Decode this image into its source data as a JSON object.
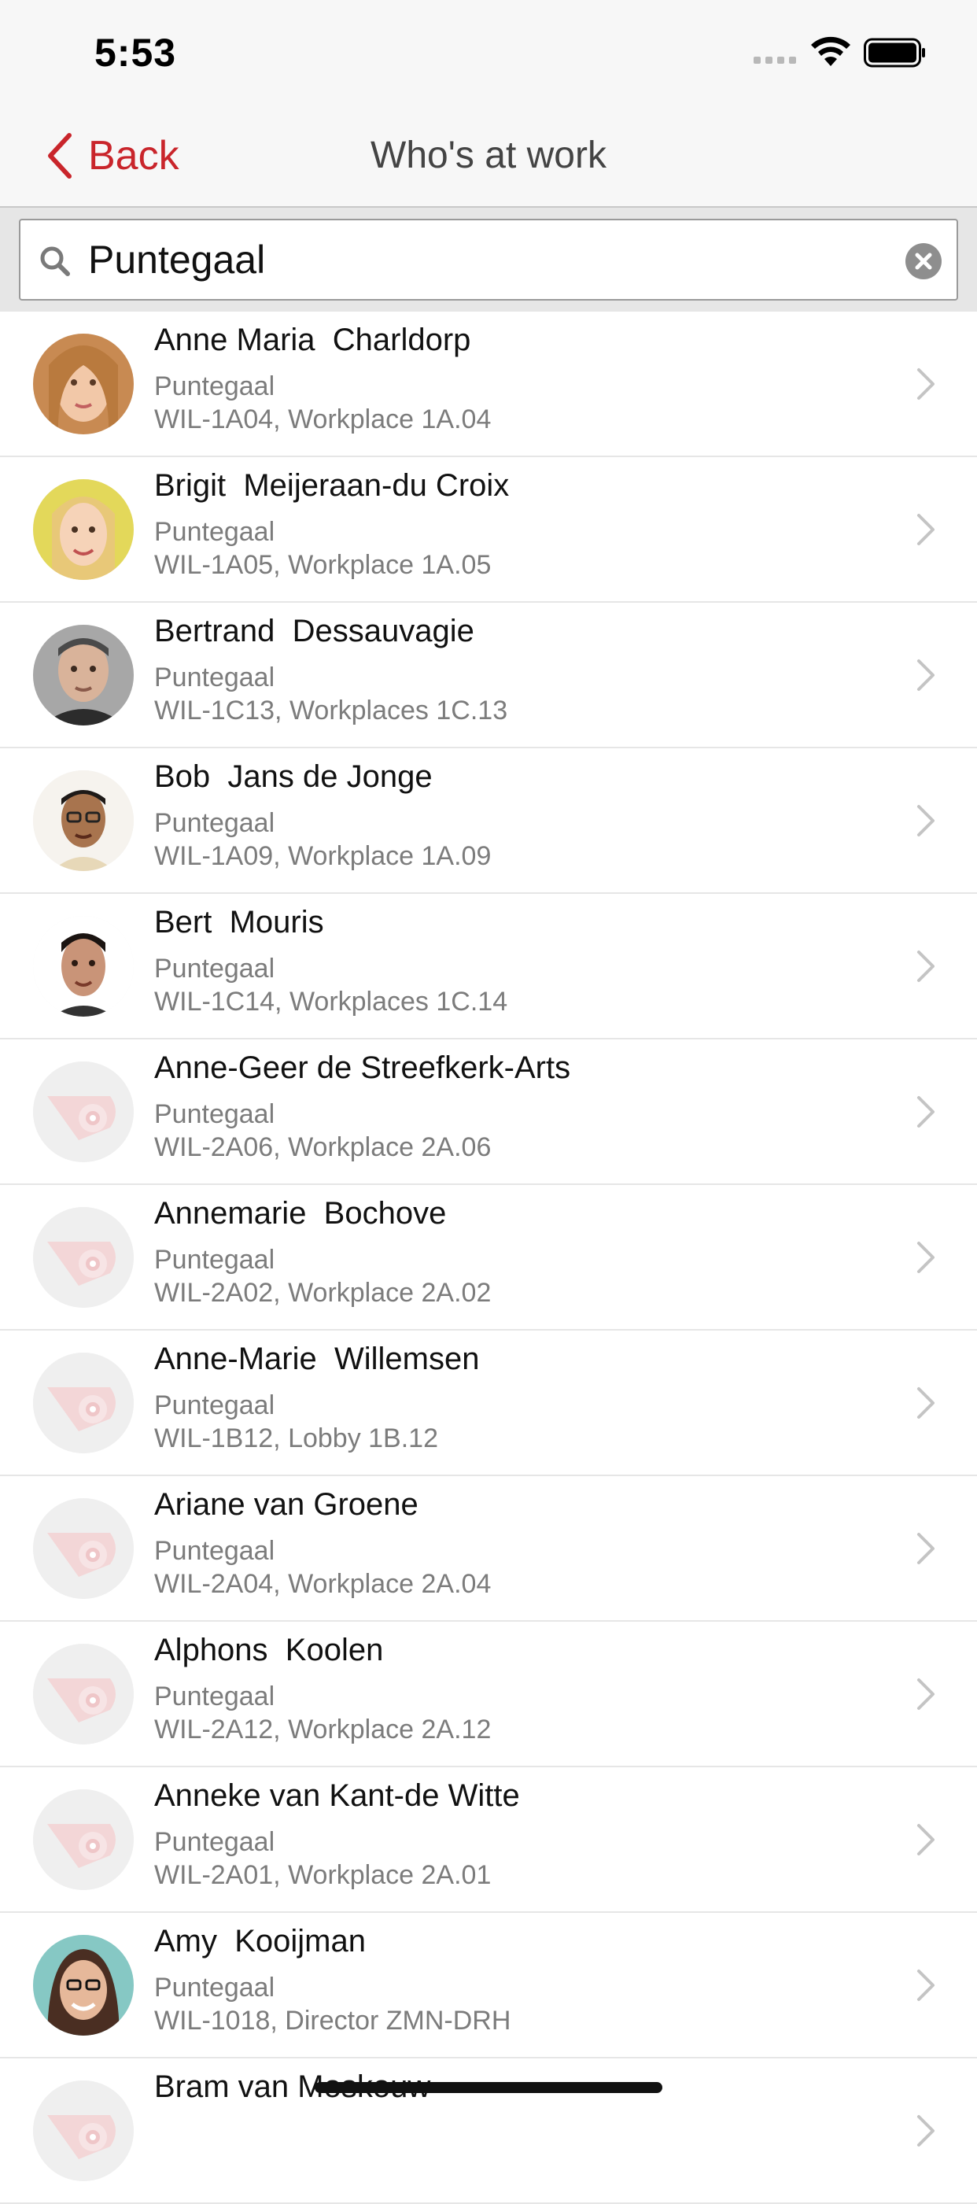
{
  "status_bar": {
    "time": "5:53"
  },
  "nav": {
    "back_label": "Back",
    "title": "Who's at work"
  },
  "search": {
    "value": "Puntegaal",
    "placeholder": ""
  },
  "colors": {
    "accent": "#c9252b",
    "secondary_text": "#7c7c7c",
    "divider": "#e6e6e6"
  },
  "people": [
    {
      "name": "Anne Maria  Charldorp",
      "department": "Puntegaal",
      "location": "WIL-1A04, Workplace 1A.04",
      "avatar": "photo-blonde-woman"
    },
    {
      "name": "Brigit  Meijeraan-du Croix",
      "department": "Puntegaal",
      "location": "WIL-1A05, Workplace 1A.05",
      "avatar": "photo-blonde-woman-yellow"
    },
    {
      "name": "Bertrand  Dessauvagie",
      "department": "Puntegaal",
      "location": "WIL-1C13, Workplaces 1C.13",
      "avatar": "photo-man-suit"
    },
    {
      "name": "Bob  Jans de Jonge",
      "department": "Puntegaal",
      "location": "WIL-1A09, Workplace 1A.09",
      "avatar": "photo-man-glasses"
    },
    {
      "name": "Bert  Mouris",
      "department": "Puntegaal",
      "location": "WIL-1C14, Workplaces 1C.14",
      "avatar": "photo-man-dark-hair"
    },
    {
      "name": "Anne-Geer de Streefkerk-Arts",
      "department": "Puntegaal",
      "location": "WIL-2A06, Workplace 2A.06",
      "avatar": "placeholder-logo"
    },
    {
      "name": "Annemarie  Bochove",
      "department": "Puntegaal",
      "location": "WIL-2A02, Workplace 2A.02",
      "avatar": "placeholder-logo"
    },
    {
      "name": "Anne-Marie  Willemsen",
      "department": "Puntegaal",
      "location": "WIL-1B12, Lobby 1B.12",
      "avatar": "placeholder-logo"
    },
    {
      "name": "Ariane van Groene",
      "department": "Puntegaal",
      "location": "WIL-2A04, Workplace 2A.04",
      "avatar": "placeholder-logo"
    },
    {
      "name": "Alphons  Koolen",
      "department": "Puntegaal",
      "location": "WIL-2A12, Workplace 2A.12",
      "avatar": "placeholder-logo"
    },
    {
      "name": "Anneke van Kant-de Witte",
      "department": "Puntegaal",
      "location": "WIL-2A01, Workplace 2A.01",
      "avatar": "placeholder-logo"
    },
    {
      "name": "Amy  Kooijman",
      "department": "Puntegaal",
      "location": "WIL-1018, Director ZMN-DRH",
      "avatar": "photo-woman-glasses"
    },
    {
      "name": "Bram van Moskouw",
      "department": "",
      "location": "",
      "avatar": "placeholder-logo"
    }
  ]
}
